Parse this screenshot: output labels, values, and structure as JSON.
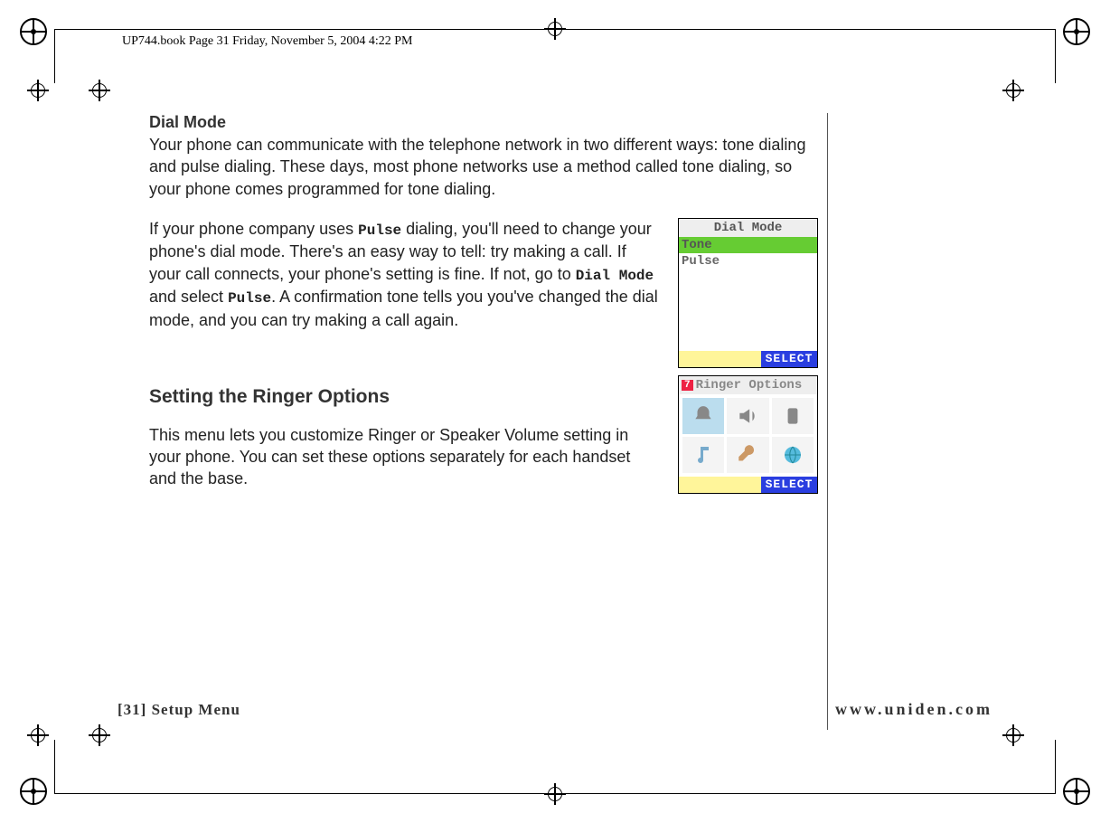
{
  "meta": {
    "header": "UP744.book  Page 31  Friday, November 5, 2004  4:22 PM"
  },
  "section1": {
    "heading": "Dial Mode",
    "para1": "Your phone can communicate with the telephone network in two different ways: tone dialing and pulse dialing. These days, most phone networks use a method called tone dialing, so your phone comes programmed for tone dialing.",
    "para2a": "If your phone company uses ",
    "para2b": " dialing, you'll need to change your phone's dial mode. There's an easy way to tell: try making a call. If your call connects, your phone's setting is fine. If not, go to ",
    "para2c": " and select ",
    "para2d": ". A confirmation tone tells you you've changed the dial mode, and you can try making a call again.",
    "code_pulse": "Pulse",
    "code_dialmode": "Dial Mode",
    "code_pulse2": "Pulse"
  },
  "screen1": {
    "title": "Dial Mode",
    "opt1": "Tone",
    "opt2": "Pulse",
    "select": "SELECT"
  },
  "section2": {
    "heading": "Setting the Ringer Options",
    "para": "This menu lets you customize Ringer or Speaker Volume setting in your phone. You can set these options separately for each handset and the base."
  },
  "screen2": {
    "badge": "7",
    "title": "Ringer Options",
    "select": "SELECT"
  },
  "footer": {
    "left_page": "[31]",
    "left_label": " Setup Menu",
    "right": "www.uniden.com"
  }
}
